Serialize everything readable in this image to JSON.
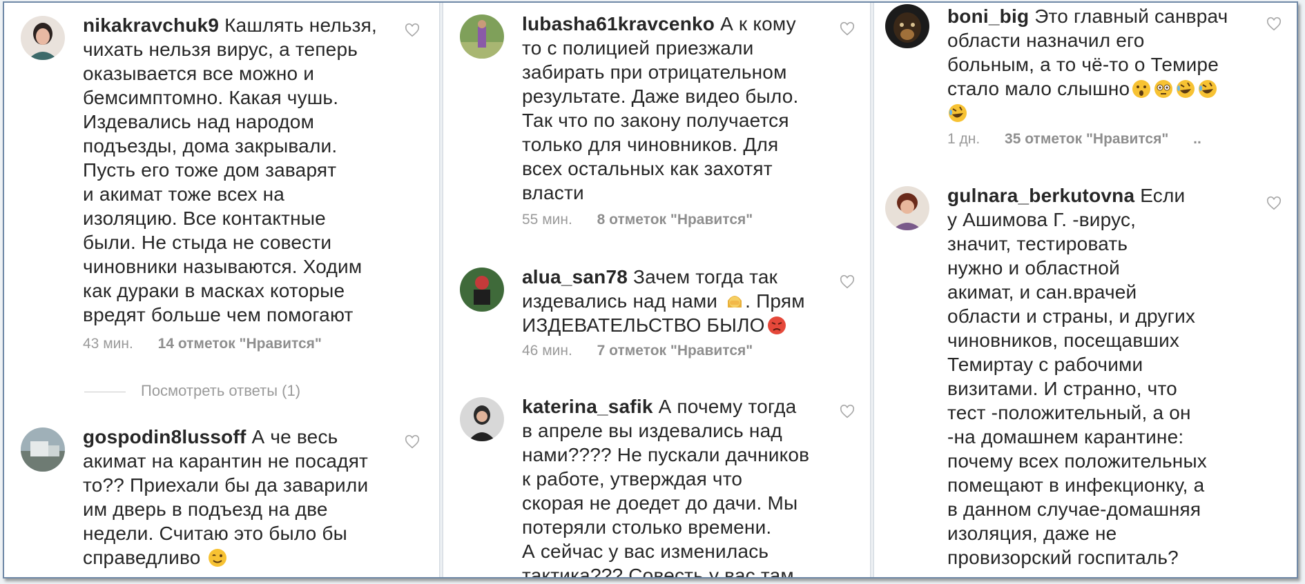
{
  "columns": [
    {
      "comments": [
        {
          "username": "nikakravchuk9",
          "lines": [
            "Кашлять нельзя,",
            "чихать нельзя вирус, а теперь",
            "оказывается все можно и",
            "бемсимптомно. Какая чушь.",
            "Издевались над народом",
            "подъезды, дома закрывали.",
            "Пусть его тоже дом заварят",
            "и акимат тоже всех на",
            "изоляцию. Все контактные",
            "были. Не стыда не совести",
            "чиновники называются. Ходим",
            "как дураки в масках которые",
            "вредят больше чем помогают"
          ],
          "time": "43 мин.",
          "likes": "14 отметок \"Нравится\""
        },
        {
          "username": "gospodin8lussoff",
          "lines": [
            "А че весь",
            "акимат на карантин не посадят",
            "то?? Приехали бы да заварили",
            "им дверь в подъезд на две",
            "недели. Считаю это было бы",
            "справедливо"
          ]
        }
      ],
      "view_replies": "Посмотреть ответы (1)"
    },
    {
      "comments": [
        {
          "username": "lubasha61kravcenko",
          "lines": [
            "А к кому",
            "то с полицией приезжали",
            "забирать при отрицательном",
            "результате. Даже видео было.",
            "Так что по закону получается",
            "только для чиновников. Для",
            "всех остальных как захотят",
            "власти"
          ],
          "time": "55 мин.",
          "likes": "8 отметок \"Нравится\""
        },
        {
          "username": "alua_san78",
          "lines": [
            "Зачем тогда так",
            "издевались над нами",
            "ИЗДЕВАТЕЛЬСТВО БЫЛО"
          ],
          "line2_suffix": ". Прям",
          "time": "46 мин.",
          "likes": "7 отметок \"Нравится\""
        },
        {
          "username": "katerina_safik",
          "lines": [
            "А почему тогда",
            "в апреле вы издевались над",
            "нами???? Не пускали дачников",
            "к работе, утверждая что",
            "скорая не доедет до дачи. Мы",
            "потеряли столько времени.",
            "А сейчас у вас изменилась",
            "тактика??? Совесть у вас там"
          ]
        }
      ]
    },
    {
      "comments": [
        {
          "username": "boni_big",
          "lines": [
            "Это главный санврач",
            "области назначил его",
            "больным, а то чё-то о Темире",
            "стало мало слышно"
          ],
          "time": "1 дн.",
          "likes": "35 отметок \"Нравится\"",
          "more": ".."
        },
        {
          "username": "gulnara_berkutovna",
          "lines": [
            "Если",
            "у Ашимова Г. -вирус,",
            "значит, тестировать",
            "нужно и областной",
            "акимат, и сан.врачей",
            "области и страны, и других",
            "чиновников, посещавших",
            "Темиртау с рабочими",
            "визитами. И странно, что",
            "тест -положительный, а он",
            "-на домашнем карантине:",
            "почему всех положительных",
            "помещают в инфекционку, а",
            "в данном случае-домашняя",
            "изоляция, даже не",
            "провизорский госпиталь?"
          ]
        }
      ]
    }
  ],
  "icons": {
    "like": "heart-outline-icon",
    "astonished": "astonished-face-emoji",
    "flushed": "flushed-face-emoji",
    "rofl": "rolling-on-floor-laughing-emoji",
    "wink": "winking-face-emoji",
    "facepalm": "woman-facepalming-emoji",
    "angry": "pouting-face-emoji"
  }
}
